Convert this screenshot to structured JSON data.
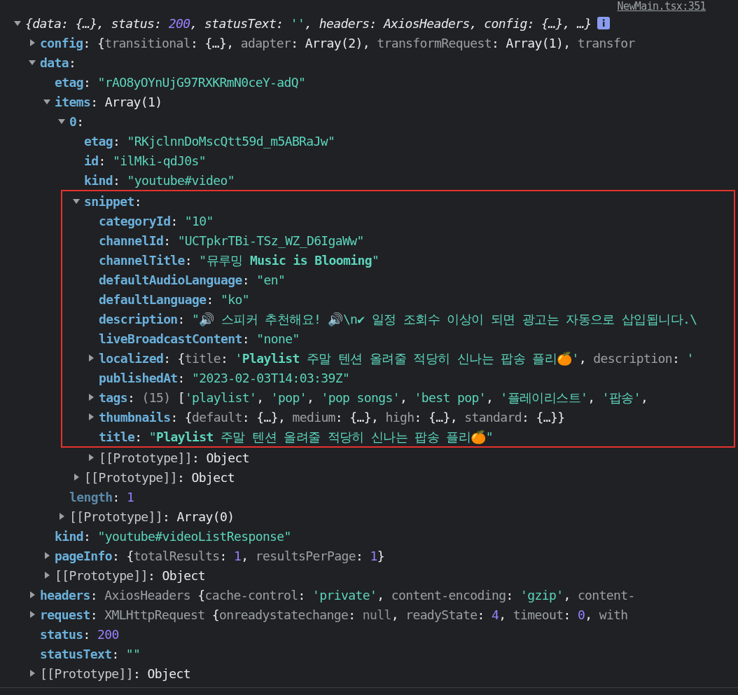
{
  "source_link": "NewMain.tsx:351",
  "tree": {
    "kind": "summary",
    "expanded": true,
    "info_badge": true,
    "segments": [
      {
        "kind": "plain",
        "text": "{data: {…}, status: "
      },
      {
        "kind": "number",
        "text": "200"
      },
      {
        "kind": "plain",
        "text": ", statusText: "
      },
      {
        "kind": "string",
        "text": "''"
      },
      {
        "kind": "plain",
        "text": ", headers: AxiosHeaders, config: {…}, …}"
      }
    ],
    "children": [
      {
        "kind": "branch",
        "expanded": false,
        "segments": [
          {
            "kind": "key",
            "text": "config"
          },
          {
            "kind": "plain",
            "text": ": {"
          },
          {
            "kind": "pkey",
            "text": "transitional"
          },
          {
            "kind": "plain",
            "text": ": {…}, "
          },
          {
            "kind": "pkey",
            "text": "adapter"
          },
          {
            "kind": "plain",
            "text": ": Array(2), "
          },
          {
            "kind": "pkey",
            "text": "transformRequest"
          },
          {
            "kind": "plain",
            "text": ": Array(1), "
          },
          {
            "kind": "pkey",
            "text": "transfor"
          }
        ]
      },
      {
        "kind": "branch",
        "expanded": true,
        "segments": [
          {
            "kind": "key",
            "text": "data"
          },
          {
            "kind": "plain",
            "text": ":"
          }
        ],
        "children": [
          {
            "kind": "leaf",
            "segments": [
              {
                "kind": "key",
                "text": "etag"
              },
              {
                "kind": "plain",
                "text": ": "
              },
              {
                "kind": "string",
                "text": "\"rAO8yOYnUjG97RXKRmN0ceY-adQ\""
              }
            ]
          },
          {
            "kind": "branch",
            "expanded": true,
            "segments": [
              {
                "kind": "key",
                "text": "items"
              },
              {
                "kind": "plain",
                "text": ": Array(1)"
              }
            ],
            "children": [
              {
                "kind": "branch",
                "expanded": true,
                "segments": [
                  {
                    "kind": "key",
                    "text": "0"
                  },
                  {
                    "kind": "plain",
                    "text": ":"
                  }
                ],
                "children": [
                  {
                    "kind": "leaf",
                    "segments": [
                      {
                        "kind": "key",
                        "text": "etag"
                      },
                      {
                        "kind": "plain",
                        "text": ": "
                      },
                      {
                        "kind": "string",
                        "text": "\"RKjclnnDoMscQtt59d_m5ABRaJw\""
                      }
                    ]
                  },
                  {
                    "kind": "leaf",
                    "segments": [
                      {
                        "kind": "key",
                        "text": "id"
                      },
                      {
                        "kind": "plain",
                        "text": ": "
                      },
                      {
                        "kind": "string",
                        "text": "\"ilMki-qdJ0s\""
                      }
                    ]
                  },
                  {
                    "kind": "leaf",
                    "segments": [
                      {
                        "kind": "key",
                        "text": "kind"
                      },
                      {
                        "kind": "plain",
                        "text": ": "
                      },
                      {
                        "kind": "string",
                        "text": "\"youtube#video\""
                      }
                    ]
                  },
                  {
                    "kind": "branch",
                    "expanded": true,
                    "highlighted": true,
                    "segments": [
                      {
                        "kind": "key",
                        "text": "snippet"
                      },
                      {
                        "kind": "plain",
                        "text": ":"
                      }
                    ],
                    "children": [
                      {
                        "kind": "leaf",
                        "segments": [
                          {
                            "kind": "key",
                            "text": "categoryId"
                          },
                          {
                            "kind": "plain",
                            "text": ": "
                          },
                          {
                            "kind": "string",
                            "text": "\"10\""
                          }
                        ]
                      },
                      {
                        "kind": "leaf",
                        "segments": [
                          {
                            "kind": "key",
                            "text": "channelId"
                          },
                          {
                            "kind": "plain",
                            "text": ": "
                          },
                          {
                            "kind": "string",
                            "text": "\"UCTpkrTBi-TSz_WZ_D6IgaWw\""
                          }
                        ]
                      },
                      {
                        "kind": "leaf",
                        "segments": [
                          {
                            "kind": "key",
                            "text": "channelTitle"
                          },
                          {
                            "kind": "plain",
                            "text": ": "
                          },
                          {
                            "kind": "string",
                            "text": "\"뮤루밍 **Music is Blooming**\""
                          }
                        ]
                      },
                      {
                        "kind": "leaf",
                        "segments": [
                          {
                            "kind": "key",
                            "text": "defaultAudioLanguage"
                          },
                          {
                            "kind": "plain",
                            "text": ": "
                          },
                          {
                            "kind": "string",
                            "text": "\"en\""
                          }
                        ]
                      },
                      {
                        "kind": "leaf",
                        "segments": [
                          {
                            "kind": "key",
                            "text": "defaultLanguage"
                          },
                          {
                            "kind": "plain",
                            "text": ": "
                          },
                          {
                            "kind": "string",
                            "text": "\"ko\""
                          }
                        ]
                      },
                      {
                        "kind": "leaf",
                        "segments": [
                          {
                            "kind": "key",
                            "text": "description"
                          },
                          {
                            "kind": "plain",
                            "text": ": "
                          },
                          {
                            "kind": "string",
                            "text": "\"🔊 스피커 추천해요! 🔊\\n✔ 일정 조회수 이상이 되면 광고는 자동으로 삽입됩니다.\\"
                          }
                        ]
                      },
                      {
                        "kind": "leaf",
                        "segments": [
                          {
                            "kind": "key",
                            "text": "liveBroadcastContent"
                          },
                          {
                            "kind": "plain",
                            "text": ": "
                          },
                          {
                            "kind": "string",
                            "text": "\"none\""
                          }
                        ]
                      },
                      {
                        "kind": "branch",
                        "expanded": false,
                        "segments": [
                          {
                            "kind": "key",
                            "text": "localized"
                          },
                          {
                            "kind": "plain",
                            "text": ": {"
                          },
                          {
                            "kind": "pkey",
                            "text": "title"
                          },
                          {
                            "kind": "plain",
                            "text": ": "
                          },
                          {
                            "kind": "string",
                            "text": "'**Playlist** 주말 텐션 올려줄 적당히 신나는 팝송 플리🍊'"
                          },
                          {
                            "kind": "plain",
                            "text": ", "
                          },
                          {
                            "kind": "pkey",
                            "text": "description"
                          },
                          {
                            "kind": "plain",
                            "text": ": "
                          },
                          {
                            "kind": "string",
                            "text": "'"
                          }
                        ]
                      },
                      {
                        "kind": "leaf",
                        "segments": [
                          {
                            "kind": "key",
                            "text": "publishedAt"
                          },
                          {
                            "kind": "plain",
                            "text": ": "
                          },
                          {
                            "kind": "string",
                            "text": "\"2023-02-03T14:03:39Z\""
                          }
                        ]
                      },
                      {
                        "kind": "branch",
                        "expanded": false,
                        "segments": [
                          {
                            "kind": "key",
                            "text": "tags"
                          },
                          {
                            "kind": "plain",
                            "text": ": "
                          },
                          {
                            "kind": "pkey",
                            "text": "(15)"
                          },
                          {
                            "kind": "plain",
                            "text": " ["
                          },
                          {
                            "kind": "string",
                            "text": "'playlist'"
                          },
                          {
                            "kind": "plain",
                            "text": ", "
                          },
                          {
                            "kind": "string",
                            "text": "'pop'"
                          },
                          {
                            "kind": "plain",
                            "text": ", "
                          },
                          {
                            "kind": "string",
                            "text": "'pop songs'"
                          },
                          {
                            "kind": "plain",
                            "text": ", "
                          },
                          {
                            "kind": "string",
                            "text": "'best pop'"
                          },
                          {
                            "kind": "plain",
                            "text": ", "
                          },
                          {
                            "kind": "string",
                            "text": "'플레이리스트'"
                          },
                          {
                            "kind": "plain",
                            "text": ", "
                          },
                          {
                            "kind": "string",
                            "text": "'팝송'"
                          },
                          {
                            "kind": "plain",
                            "text": ","
                          }
                        ]
                      },
                      {
                        "kind": "branch",
                        "expanded": false,
                        "segments": [
                          {
                            "kind": "key",
                            "text": "thumbnails"
                          },
                          {
                            "kind": "plain",
                            "text": ": {"
                          },
                          {
                            "kind": "pkey",
                            "text": "default"
                          },
                          {
                            "kind": "plain",
                            "text": ": {…}, "
                          },
                          {
                            "kind": "pkey",
                            "text": "medium"
                          },
                          {
                            "kind": "plain",
                            "text": ": {…}, "
                          },
                          {
                            "kind": "pkey",
                            "text": "high"
                          },
                          {
                            "kind": "plain",
                            "text": ": {…}, "
                          },
                          {
                            "kind": "pkey",
                            "text": "standard"
                          },
                          {
                            "kind": "plain",
                            "text": ": {…}}"
                          }
                        ]
                      },
                      {
                        "kind": "leaf",
                        "segments": [
                          {
                            "kind": "key",
                            "text": "title"
                          },
                          {
                            "kind": "plain",
                            "text": ": "
                          },
                          {
                            "kind": "string",
                            "text": "\"**Playlist** 주말 텐션 올려줄 적당히 신나는 팝송 플리🍊\""
                          }
                        ]
                      },
                      {
                        "kind": "branch",
                        "expanded": false,
                        "segments": [
                          {
                            "kind": "internal",
                            "text": "[[Prototype]]"
                          },
                          {
                            "kind": "plain",
                            "text": ": Object"
                          }
                        ]
                      }
                    ]
                  },
                  {
                    "kind": "branch",
                    "expanded": false,
                    "segments": [
                      {
                        "kind": "internal",
                        "text": "[[Prototype]]"
                      },
                      {
                        "kind": "plain",
                        "text": ": Object"
                      }
                    ]
                  }
                ]
              },
              {
                "kind": "leaf",
                "segments": [
                  {
                    "kind": "dimkey",
                    "text": "length"
                  },
                  {
                    "kind": "plain",
                    "text": ": "
                  },
                  {
                    "kind": "number",
                    "text": "1"
                  }
                ]
              },
              {
                "kind": "branch",
                "expanded": false,
                "segments": [
                  {
                    "kind": "internal",
                    "text": "[[Prototype]]"
                  },
                  {
                    "kind": "plain",
                    "text": ": Array(0)"
                  }
                ]
              }
            ]
          },
          {
            "kind": "leaf",
            "segments": [
              {
                "kind": "key",
                "text": "kind"
              },
              {
                "kind": "plain",
                "text": ": "
              },
              {
                "kind": "string",
                "text": "\"youtube#videoListResponse\""
              }
            ]
          },
          {
            "kind": "branch",
            "expanded": false,
            "segments": [
              {
                "kind": "key",
                "text": "pageInfo"
              },
              {
                "kind": "plain",
                "text": ": {"
              },
              {
                "kind": "pkey",
                "text": "totalResults"
              },
              {
                "kind": "plain",
                "text": ": "
              },
              {
                "kind": "number",
                "text": "1"
              },
              {
                "kind": "plain",
                "text": ", "
              },
              {
                "kind": "pkey",
                "text": "resultsPerPage"
              },
              {
                "kind": "plain",
                "text": ": "
              },
              {
                "kind": "number",
                "text": "1"
              },
              {
                "kind": "plain",
                "text": "}"
              }
            ]
          },
          {
            "kind": "branch",
            "expanded": false,
            "segments": [
              {
                "kind": "internal",
                "text": "[[Prototype]]"
              },
              {
                "kind": "plain",
                "text": ": Object"
              }
            ]
          }
        ]
      },
      {
        "kind": "branch",
        "expanded": false,
        "segments": [
          {
            "kind": "key",
            "text": "headers"
          },
          {
            "kind": "plain",
            "text": ": "
          },
          {
            "kind": "pkey",
            "text": "AxiosHeaders"
          },
          {
            "kind": "plain",
            "text": " {"
          },
          {
            "kind": "pkey",
            "text": "cache-control"
          },
          {
            "kind": "plain",
            "text": ": "
          },
          {
            "kind": "string",
            "text": "'private'"
          },
          {
            "kind": "plain",
            "text": ", "
          },
          {
            "kind": "pkey",
            "text": "content-encoding"
          },
          {
            "kind": "plain",
            "text": ": "
          },
          {
            "kind": "string",
            "text": "'gzip'"
          },
          {
            "kind": "plain",
            "text": ", "
          },
          {
            "kind": "pkey",
            "text": "content-"
          }
        ]
      },
      {
        "kind": "branch",
        "expanded": false,
        "segments": [
          {
            "kind": "key",
            "text": "request"
          },
          {
            "kind": "plain",
            "text": ": "
          },
          {
            "kind": "pkey",
            "text": "XMLHttpRequest"
          },
          {
            "kind": "plain",
            "text": " {"
          },
          {
            "kind": "pkey",
            "text": "onreadystatechange"
          },
          {
            "kind": "plain",
            "text": ": "
          },
          {
            "kind": "null",
            "text": "null"
          },
          {
            "kind": "plain",
            "text": ", "
          },
          {
            "kind": "pkey",
            "text": "readyState"
          },
          {
            "kind": "plain",
            "text": ": "
          },
          {
            "kind": "number",
            "text": "4"
          },
          {
            "kind": "plain",
            "text": ", "
          },
          {
            "kind": "pkey",
            "text": "timeout"
          },
          {
            "kind": "plain",
            "text": ": "
          },
          {
            "kind": "number",
            "text": "0"
          },
          {
            "kind": "plain",
            "text": ", "
          },
          {
            "kind": "pkey",
            "text": "with"
          }
        ]
      },
      {
        "kind": "leaf",
        "segments": [
          {
            "kind": "key",
            "text": "status"
          },
          {
            "kind": "plain",
            "text": ": "
          },
          {
            "kind": "number",
            "text": "200"
          }
        ]
      },
      {
        "kind": "leaf",
        "segments": [
          {
            "kind": "key",
            "text": "statusText"
          },
          {
            "kind": "plain",
            "text": ": "
          },
          {
            "kind": "string",
            "text": "\"\""
          }
        ]
      },
      {
        "kind": "branch",
        "expanded": false,
        "segments": [
          {
            "kind": "internal",
            "text": "[[Prototype]]"
          },
          {
            "kind": "plain",
            "text": ": Object"
          }
        ]
      }
    ]
  }
}
